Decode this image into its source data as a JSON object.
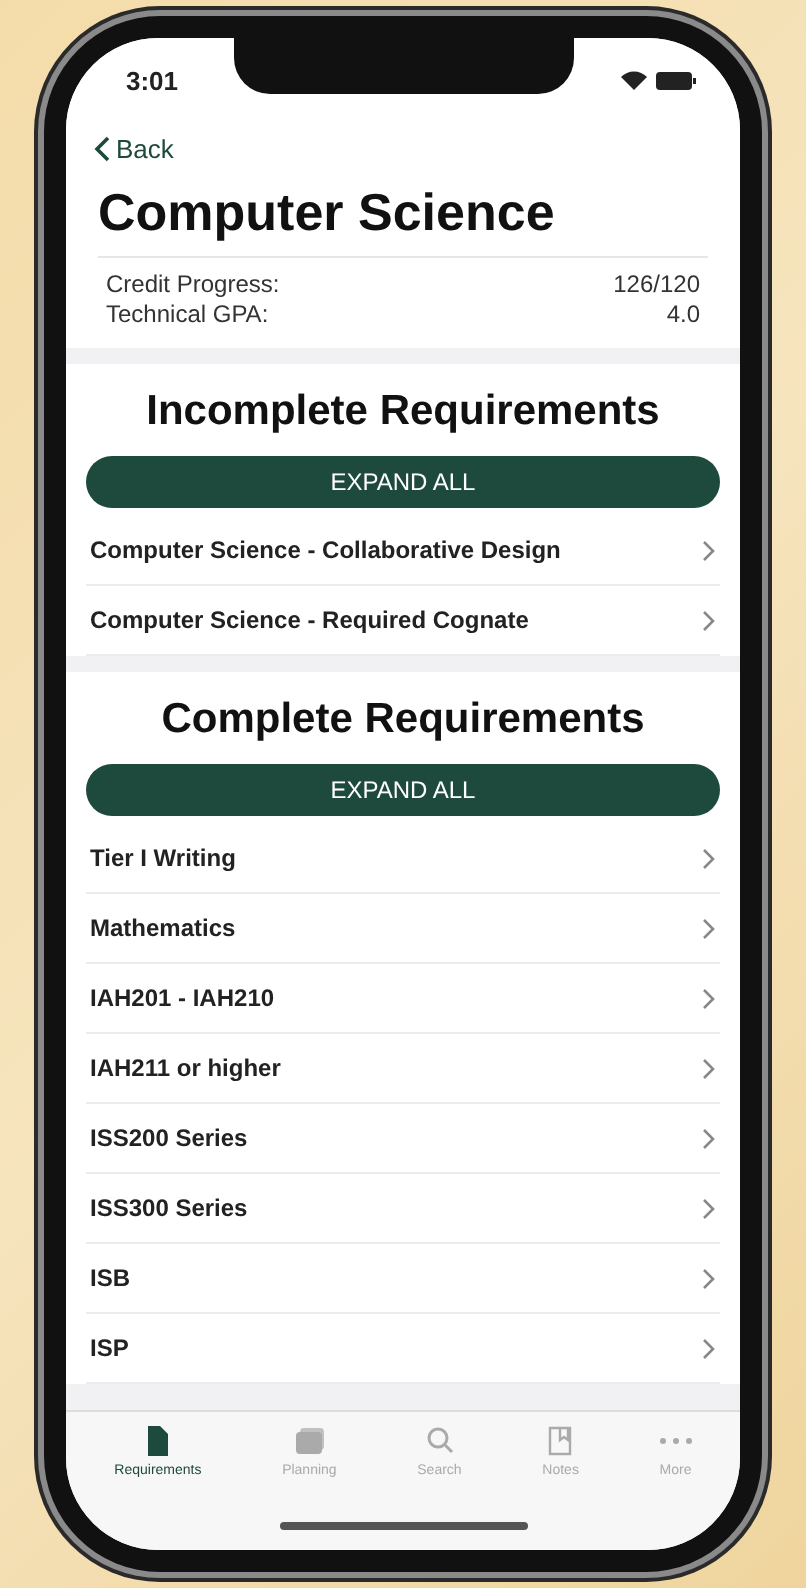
{
  "status_bar": {
    "time": "3:01"
  },
  "nav": {
    "back": "Back"
  },
  "title": "Computer Science",
  "summary": [
    {
      "label": "Credit Progress:",
      "value": "126/120"
    },
    {
      "label": "Technical GPA:",
      "value": "4.0"
    }
  ],
  "sections": [
    {
      "heading": "Incomplete Requirements",
      "button": "EXPAND ALL",
      "items": [
        "Computer Science - Collaborative Design",
        "Computer Science - Required Cognate"
      ]
    },
    {
      "heading": "Complete Requirements",
      "button": "EXPAND ALL",
      "items": [
        "Tier I Writing",
        "Mathematics",
        "IAH201 - IAH210",
        "IAH211 or higher",
        "ISS200 Series",
        "ISS300 Series",
        "ISB",
        "ISP"
      ]
    }
  ],
  "tab_bar": [
    {
      "label": "Requirements",
      "kind": "document",
      "selected": true
    },
    {
      "label": "Planning",
      "kind": "folders",
      "selected": false
    },
    {
      "label": "Search",
      "kind": "search",
      "selected": false
    },
    {
      "label": "Notes",
      "kind": "note",
      "selected": false
    },
    {
      "label": "More",
      "kind": "more",
      "selected": false
    }
  ]
}
